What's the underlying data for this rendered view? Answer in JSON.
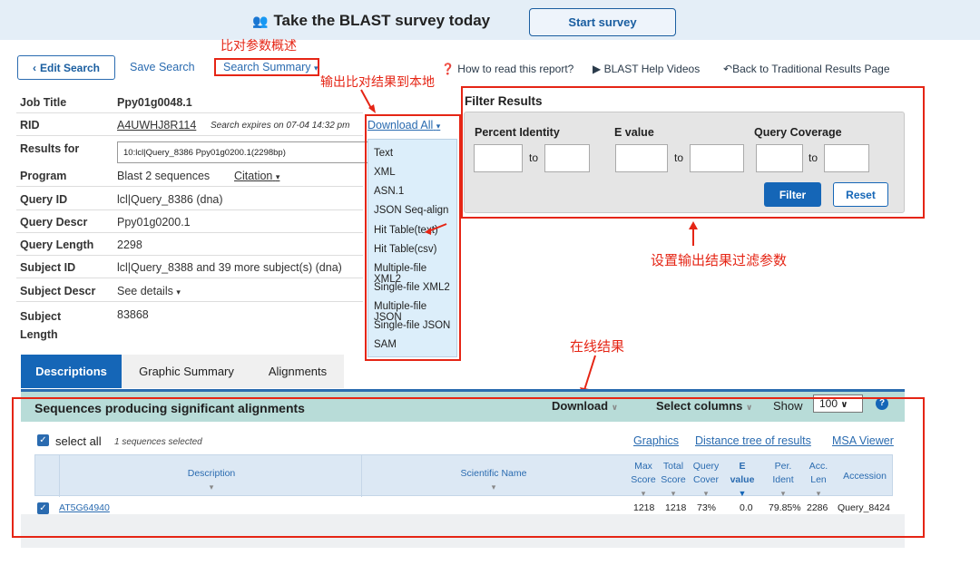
{
  "banner": {
    "icon": "people-icon",
    "title": "Take the BLAST survey today",
    "survey_button": "Start survey"
  },
  "toolbar": {
    "edit_search": "Edit Search",
    "save_search": "Save Search",
    "search_summary": "Search Summary",
    "how_to_read": "How to read this report?",
    "help_videos": "BLAST Help Videos",
    "back_traditional": "Back to Traditional Results Page"
  },
  "annotations": {
    "summary_note": "比对参数概述",
    "download_note": "输出比对结果到本地",
    "filter_note": "设置输出结果过滤参数",
    "online_note": "在线结果"
  },
  "job": {
    "rows": [
      {
        "label": "Job Title",
        "value": "Ppy01g0048.1"
      },
      {
        "label": "RID",
        "value": "A4UWHJ8R114",
        "expires": "Search expires on 07-04 14:32 pm"
      },
      {
        "label": "Results for",
        "value": "10:lcl|Query_8386 Ppy01g0200.1(2298bp)"
      },
      {
        "label": "Program",
        "value": "Blast 2 sequences",
        "extra": "Citation"
      },
      {
        "label": "Query ID",
        "value": "lcl|Query_8386 (dna)"
      },
      {
        "label": "Query Descr",
        "value": "Ppy01g0200.1"
      },
      {
        "label": "Query Length",
        "value": "2298"
      },
      {
        "label": "Subject ID",
        "value": "lcl|Query_8388 and 39 more subject(s) (dna)"
      },
      {
        "label": "Subject Descr",
        "value": "See details"
      },
      {
        "label": "Subject Length",
        "value": "83868"
      }
    ]
  },
  "download": {
    "label": "Download All",
    "options": [
      "Text",
      "XML",
      "ASN.1",
      "JSON Seq-align",
      "Hit Table(text)",
      "Hit Table(csv)",
      "Multiple-file XML2",
      "Single-file XML2",
      "Multiple-file JSON",
      "Single-file JSON",
      "SAM"
    ]
  },
  "filter": {
    "title": "Filter Results",
    "percent_identity": "Percent Identity",
    "e_value": "E value",
    "query_coverage": "Query Coverage",
    "to": "to",
    "filter_button": "Filter",
    "reset_button": "Reset"
  },
  "tabs": [
    "Descriptions",
    "Graphic Summary",
    "Alignments"
  ],
  "results": {
    "heading": "Sequences producing significant alignments",
    "download": "Download",
    "select_columns": "Select columns",
    "show": "Show",
    "show_value": "100",
    "select_all": "select all",
    "selected_count": "1 sequences selected",
    "links": [
      "Graphics",
      "Distance tree of results",
      "MSA Viewer"
    ],
    "columns": [
      "Description",
      "Scientific Name",
      "Max Score",
      "Total Score",
      "Query Cover",
      "E value",
      "Per. Ident",
      "Acc. Len",
      "Accession"
    ],
    "rows": [
      {
        "description": "AT5G64940",
        "scientific_name": "",
        "max_score": "1218",
        "total_score": "1218",
        "query_cover": "73%",
        "e_value": "0.0",
        "per_ident": "79.85%",
        "acc_len": "2286",
        "accession": "Query_8424"
      }
    ]
  },
  "colors": {
    "accent": "#2a6bb0",
    "annotation_red": "#e52515",
    "banner_bg": "#e4eef7",
    "results_bar": "#b8dcd8"
  }
}
